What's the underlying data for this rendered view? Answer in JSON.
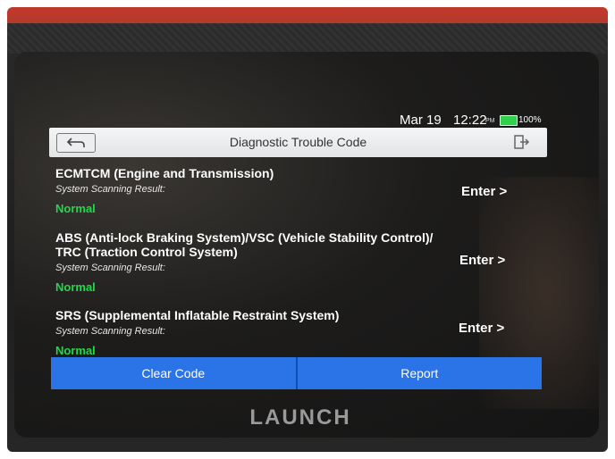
{
  "status": {
    "date": "Mar 19",
    "time": "12:22",
    "ampm": "PM",
    "battery": "100%"
  },
  "header": {
    "title": "Diagnostic Trouble Code"
  },
  "systems": [
    {
      "name_lines": [
        "ECMTCM (Engine and Transmission)"
      ],
      "result_label": "System Scanning Result:",
      "status": "Normal",
      "enter": "Enter >"
    },
    {
      "name_lines": [
        "ABS (Anti-lock Braking System)/VSC (Vehicle Stability Control)/",
        "TRC (Traction Control System)"
      ],
      "result_label": "System Scanning Result:",
      "status": "Normal",
      "enter": "Enter >"
    },
    {
      "name_lines": [
        "SRS (Supplemental Inflatable Restraint System)"
      ],
      "result_label": "System Scanning Result:",
      "status": "Normal",
      "enter": "Enter >"
    }
  ],
  "footer": {
    "clear_label": "Clear Code",
    "report_label": "Report"
  },
  "device": {
    "brand": "LAUNCH"
  },
  "colors": {
    "accent": "#2a74e8",
    "normal": "#22d84a",
    "battery": "#2fd24a"
  },
  "icons": {
    "back": "back-arrow-icon",
    "exit": "exit-icon",
    "battery": "battery-icon"
  }
}
